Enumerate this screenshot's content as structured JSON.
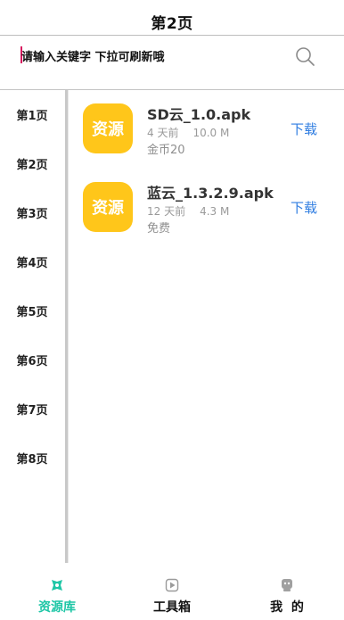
{
  "header": {
    "title": "第2页"
  },
  "search": {
    "placeholder": "请输入关键字 下拉可刷新哦",
    "icon": "search-icon"
  },
  "sidebar": {
    "items": [
      "第1页",
      "第2页",
      "第3页",
      "第4页",
      "第5页",
      "第6页",
      "第7页",
      "第8页"
    ]
  },
  "list": {
    "items": [
      {
        "badge": "资源",
        "name": "SD云_1.0.apk",
        "age": "4 天前",
        "size": "10.0 M",
        "price": "金币20",
        "action": "下载"
      },
      {
        "badge": "资源",
        "name": "蓝云_1.3.2.9.apk",
        "age": "12 天前",
        "size": "4.3 M",
        "price": "免费",
        "action": "下载"
      }
    ]
  },
  "tabbar": {
    "tabs": [
      {
        "label": "资源库",
        "icon": "resource-icon",
        "active": true
      },
      {
        "label": "工具箱",
        "icon": "play-icon",
        "active": false
      },
      {
        "label": "我  的",
        "icon": "profile-icon",
        "active": false
      }
    ]
  },
  "colors": {
    "accent": "#1ec6a6",
    "badge": "#ffc61a",
    "link": "#2f7de1",
    "caret": "#d81b60"
  }
}
